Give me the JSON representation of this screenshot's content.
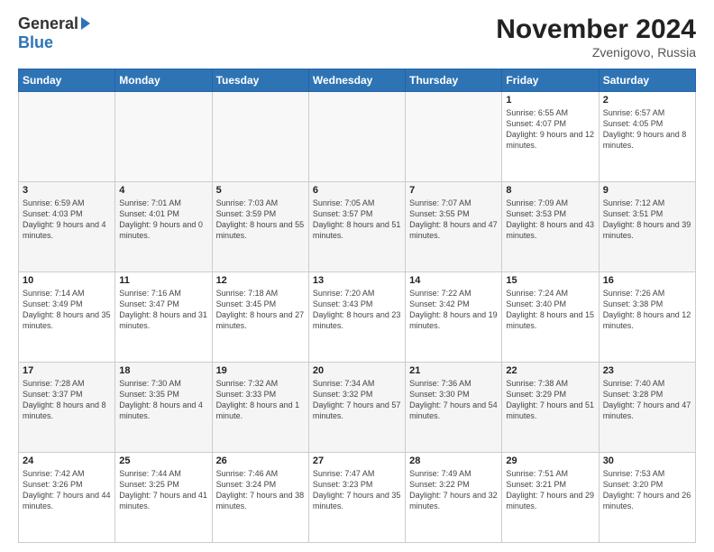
{
  "header": {
    "logo_general": "General",
    "logo_blue": "Blue",
    "main_title": "November 2024",
    "subtitle": "Zvenigovo, Russia"
  },
  "days_of_week": [
    "Sunday",
    "Monday",
    "Tuesday",
    "Wednesday",
    "Thursday",
    "Friday",
    "Saturday"
  ],
  "weeks": [
    [
      {
        "day": "",
        "info": ""
      },
      {
        "day": "",
        "info": ""
      },
      {
        "day": "",
        "info": ""
      },
      {
        "day": "",
        "info": ""
      },
      {
        "day": "",
        "info": ""
      },
      {
        "day": "1",
        "info": "Sunrise: 6:55 AM\nSunset: 4:07 PM\nDaylight: 9 hours and 12 minutes."
      },
      {
        "day": "2",
        "info": "Sunrise: 6:57 AM\nSunset: 4:05 PM\nDaylight: 9 hours and 8 minutes."
      }
    ],
    [
      {
        "day": "3",
        "info": "Sunrise: 6:59 AM\nSunset: 4:03 PM\nDaylight: 9 hours and 4 minutes."
      },
      {
        "day": "4",
        "info": "Sunrise: 7:01 AM\nSunset: 4:01 PM\nDaylight: 9 hours and 0 minutes."
      },
      {
        "day": "5",
        "info": "Sunrise: 7:03 AM\nSunset: 3:59 PM\nDaylight: 8 hours and 55 minutes."
      },
      {
        "day": "6",
        "info": "Sunrise: 7:05 AM\nSunset: 3:57 PM\nDaylight: 8 hours and 51 minutes."
      },
      {
        "day": "7",
        "info": "Sunrise: 7:07 AM\nSunset: 3:55 PM\nDaylight: 8 hours and 47 minutes."
      },
      {
        "day": "8",
        "info": "Sunrise: 7:09 AM\nSunset: 3:53 PM\nDaylight: 8 hours and 43 minutes."
      },
      {
        "day": "9",
        "info": "Sunrise: 7:12 AM\nSunset: 3:51 PM\nDaylight: 8 hours and 39 minutes."
      }
    ],
    [
      {
        "day": "10",
        "info": "Sunrise: 7:14 AM\nSunset: 3:49 PM\nDaylight: 8 hours and 35 minutes."
      },
      {
        "day": "11",
        "info": "Sunrise: 7:16 AM\nSunset: 3:47 PM\nDaylight: 8 hours and 31 minutes."
      },
      {
        "day": "12",
        "info": "Sunrise: 7:18 AM\nSunset: 3:45 PM\nDaylight: 8 hours and 27 minutes."
      },
      {
        "day": "13",
        "info": "Sunrise: 7:20 AM\nSunset: 3:43 PM\nDaylight: 8 hours and 23 minutes."
      },
      {
        "day": "14",
        "info": "Sunrise: 7:22 AM\nSunset: 3:42 PM\nDaylight: 8 hours and 19 minutes."
      },
      {
        "day": "15",
        "info": "Sunrise: 7:24 AM\nSunset: 3:40 PM\nDaylight: 8 hours and 15 minutes."
      },
      {
        "day": "16",
        "info": "Sunrise: 7:26 AM\nSunset: 3:38 PM\nDaylight: 8 hours and 12 minutes."
      }
    ],
    [
      {
        "day": "17",
        "info": "Sunrise: 7:28 AM\nSunset: 3:37 PM\nDaylight: 8 hours and 8 minutes."
      },
      {
        "day": "18",
        "info": "Sunrise: 7:30 AM\nSunset: 3:35 PM\nDaylight: 8 hours and 4 minutes."
      },
      {
        "day": "19",
        "info": "Sunrise: 7:32 AM\nSunset: 3:33 PM\nDaylight: 8 hours and 1 minute."
      },
      {
        "day": "20",
        "info": "Sunrise: 7:34 AM\nSunset: 3:32 PM\nDaylight: 7 hours and 57 minutes."
      },
      {
        "day": "21",
        "info": "Sunrise: 7:36 AM\nSunset: 3:30 PM\nDaylight: 7 hours and 54 minutes."
      },
      {
        "day": "22",
        "info": "Sunrise: 7:38 AM\nSunset: 3:29 PM\nDaylight: 7 hours and 51 minutes."
      },
      {
        "day": "23",
        "info": "Sunrise: 7:40 AM\nSunset: 3:28 PM\nDaylight: 7 hours and 47 minutes."
      }
    ],
    [
      {
        "day": "24",
        "info": "Sunrise: 7:42 AM\nSunset: 3:26 PM\nDaylight: 7 hours and 44 minutes."
      },
      {
        "day": "25",
        "info": "Sunrise: 7:44 AM\nSunset: 3:25 PM\nDaylight: 7 hours and 41 minutes."
      },
      {
        "day": "26",
        "info": "Sunrise: 7:46 AM\nSunset: 3:24 PM\nDaylight: 7 hours and 38 minutes."
      },
      {
        "day": "27",
        "info": "Sunrise: 7:47 AM\nSunset: 3:23 PM\nDaylight: 7 hours and 35 minutes."
      },
      {
        "day": "28",
        "info": "Sunrise: 7:49 AM\nSunset: 3:22 PM\nDaylight: 7 hours and 32 minutes."
      },
      {
        "day": "29",
        "info": "Sunrise: 7:51 AM\nSunset: 3:21 PM\nDaylight: 7 hours and 29 minutes."
      },
      {
        "day": "30",
        "info": "Sunrise: 7:53 AM\nSunset: 3:20 PM\nDaylight: 7 hours and 26 minutes."
      }
    ]
  ]
}
